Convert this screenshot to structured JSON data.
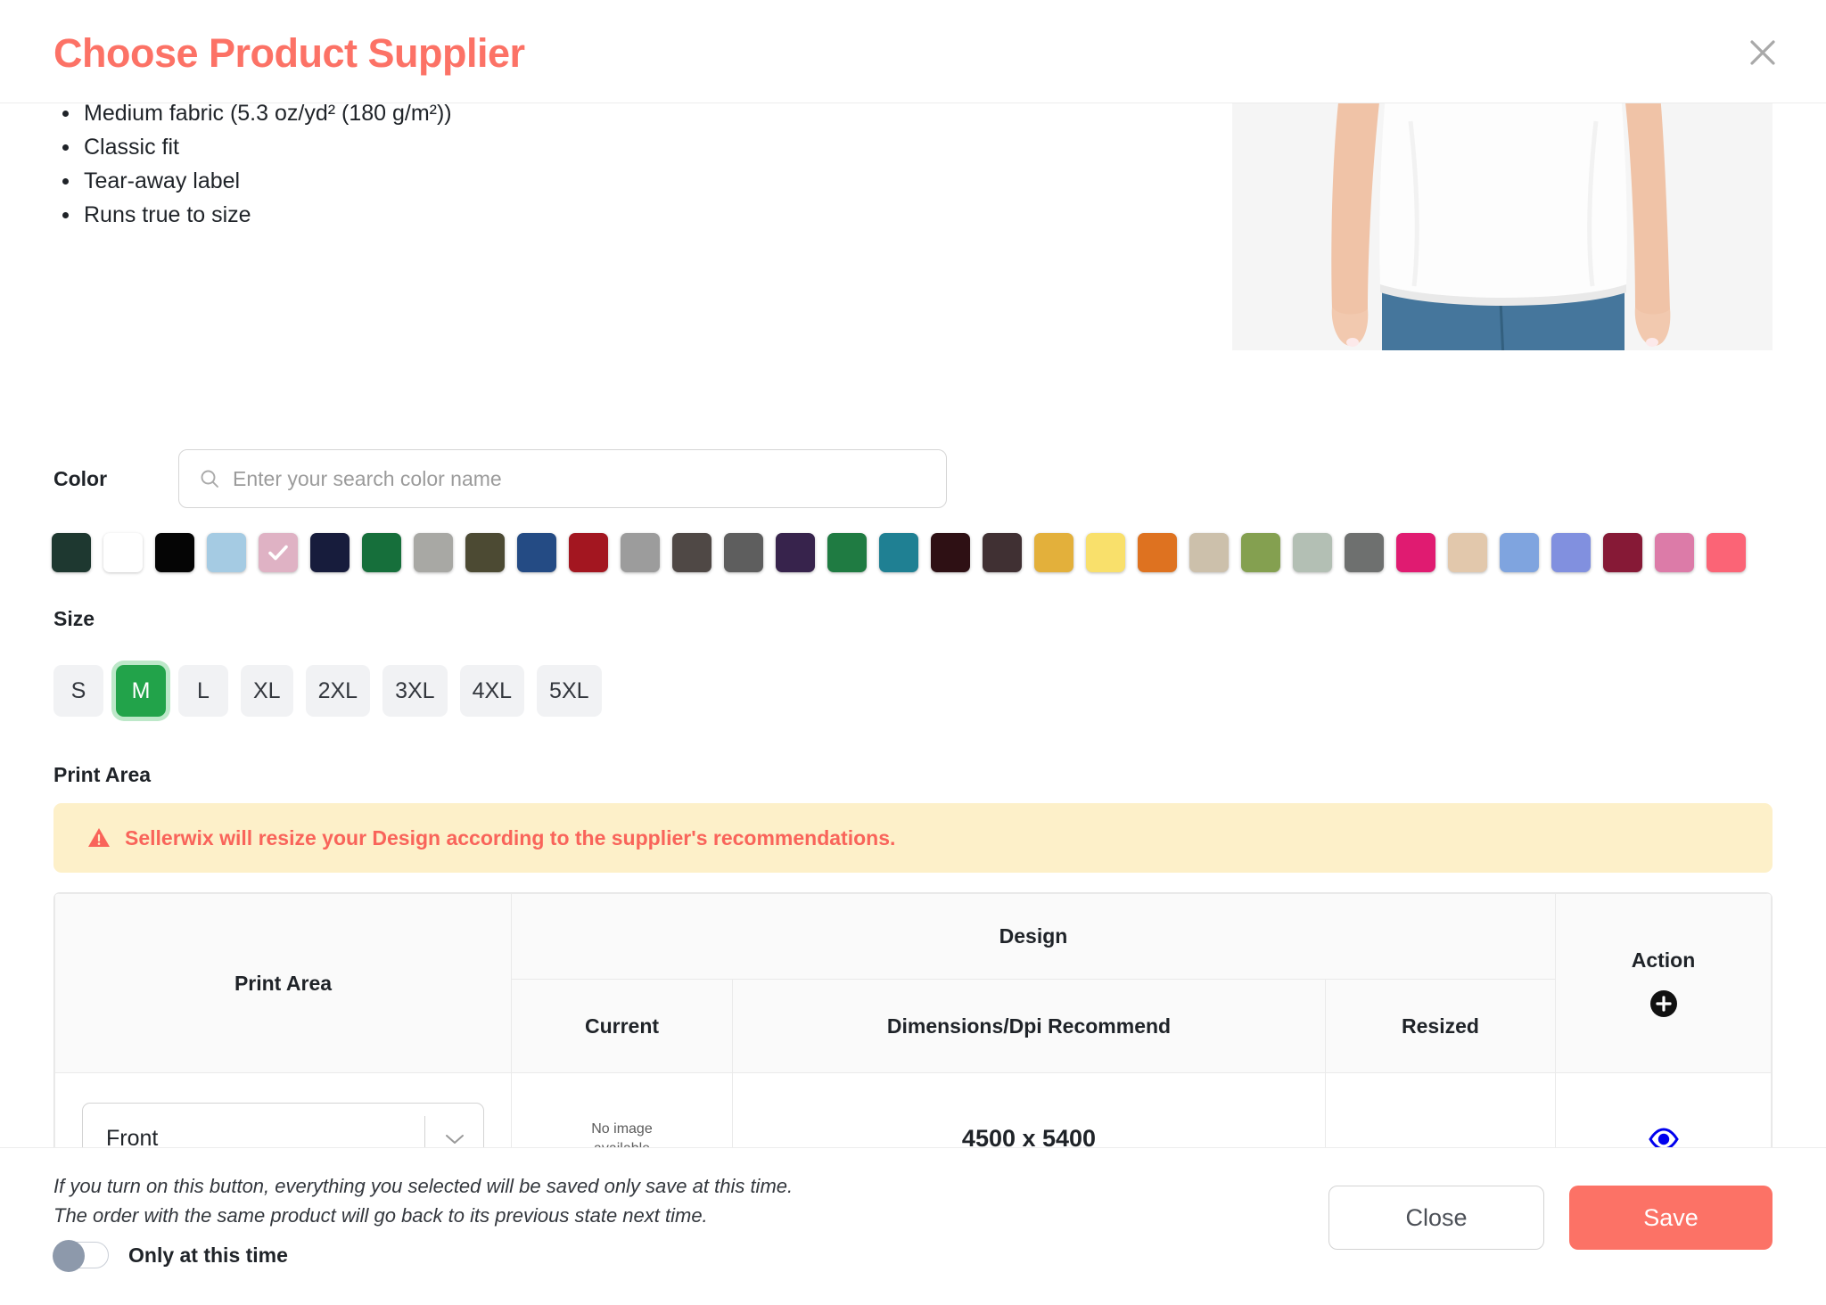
{
  "header": {
    "title": "Choose Product Supplier",
    "close_icon": "close-icon"
  },
  "description": {
    "bullets": [
      "Medium fabric (5.3 oz/yd² (180 g/m²))",
      "Classic fit",
      "Tear-away label",
      "Runs true to size"
    ]
  },
  "color": {
    "label": "Color",
    "search_placeholder": "Enter your search color name",
    "search_value": "",
    "search_icon": "search-icon",
    "selected_index": 4,
    "swatches": [
      {
        "hex": "#1E3830"
      },
      {
        "hex": "#FFFFFF"
      },
      {
        "hex": "#050505"
      },
      {
        "hex": "#A5CBE3"
      },
      {
        "hex": "#DFB2C4"
      },
      {
        "hex": "#171C3C"
      },
      {
        "hex": "#166F3B"
      },
      {
        "hex": "#A8A8A4"
      },
      {
        "hex": "#4C4A33"
      },
      {
        "hex": "#244B84"
      },
      {
        "hex": "#A31620"
      },
      {
        "hex": "#9C9C9C"
      },
      {
        "hex": "#4F4845"
      },
      {
        "hex": "#5E5E5E"
      },
      {
        "hex": "#37234C"
      },
      {
        "hex": "#1F7B42"
      },
      {
        "hex": "#1F8093"
      },
      {
        "hex": "#2E1014"
      },
      {
        "hex": "#403033"
      },
      {
        "hex": "#E3B03B"
      },
      {
        "hex": "#F9E06B"
      },
      {
        "hex": "#DE7220"
      },
      {
        "hex": "#CCC0AB"
      },
      {
        "hex": "#84A050"
      },
      {
        "hex": "#B3BFB4"
      },
      {
        "hex": "#6E706F"
      },
      {
        "hex": "#E01B71"
      },
      {
        "hex": "#E2C8AC"
      },
      {
        "hex": "#7FA4DF"
      },
      {
        "hex": "#8190DF"
      },
      {
        "hex": "#861936"
      },
      {
        "hex": "#DC7BA8"
      },
      {
        "hex": "#FB6476"
      }
    ]
  },
  "size": {
    "label": "Size",
    "options": [
      "S",
      "M",
      "L",
      "XL",
      "2XL",
      "3XL",
      "4XL",
      "5XL"
    ],
    "selected": "M",
    "selected_color": "#22A34A"
  },
  "print_area": {
    "label": "Print Area",
    "alert": {
      "icon": "warning-triangle-icon",
      "text": "Sellerwix will resize your Design according to the supplier's recommendations.",
      "text_color": "#F9645A",
      "background": "#FDF0C9"
    },
    "table": {
      "headers": {
        "print_area": "Print Area",
        "design": "Design",
        "action": "Action",
        "current": "Current",
        "dimensions": "Dimensions/Dpi Recommend",
        "resized": "Resized"
      },
      "add_icon": "plus-circle-icon",
      "rows": [
        {
          "print_area_value": "Front",
          "current": "No image\navailable",
          "current_line1": "No image",
          "current_line2": "available",
          "dimensions": "4500 x 5400",
          "resized": "",
          "action_icon": "eye-icon",
          "action_icon_color": "#0000EE"
        }
      ]
    }
  },
  "footer": {
    "note_line1": "If you turn on this button, everything you selected will be saved only save at this time.",
    "note_line2": "The order with the same product will go back to its previous state next time.",
    "toggle_label": "Only at this time",
    "toggle_on": false,
    "close_label": "Close",
    "save_label": "Save",
    "save_color": "#FC7266"
  }
}
